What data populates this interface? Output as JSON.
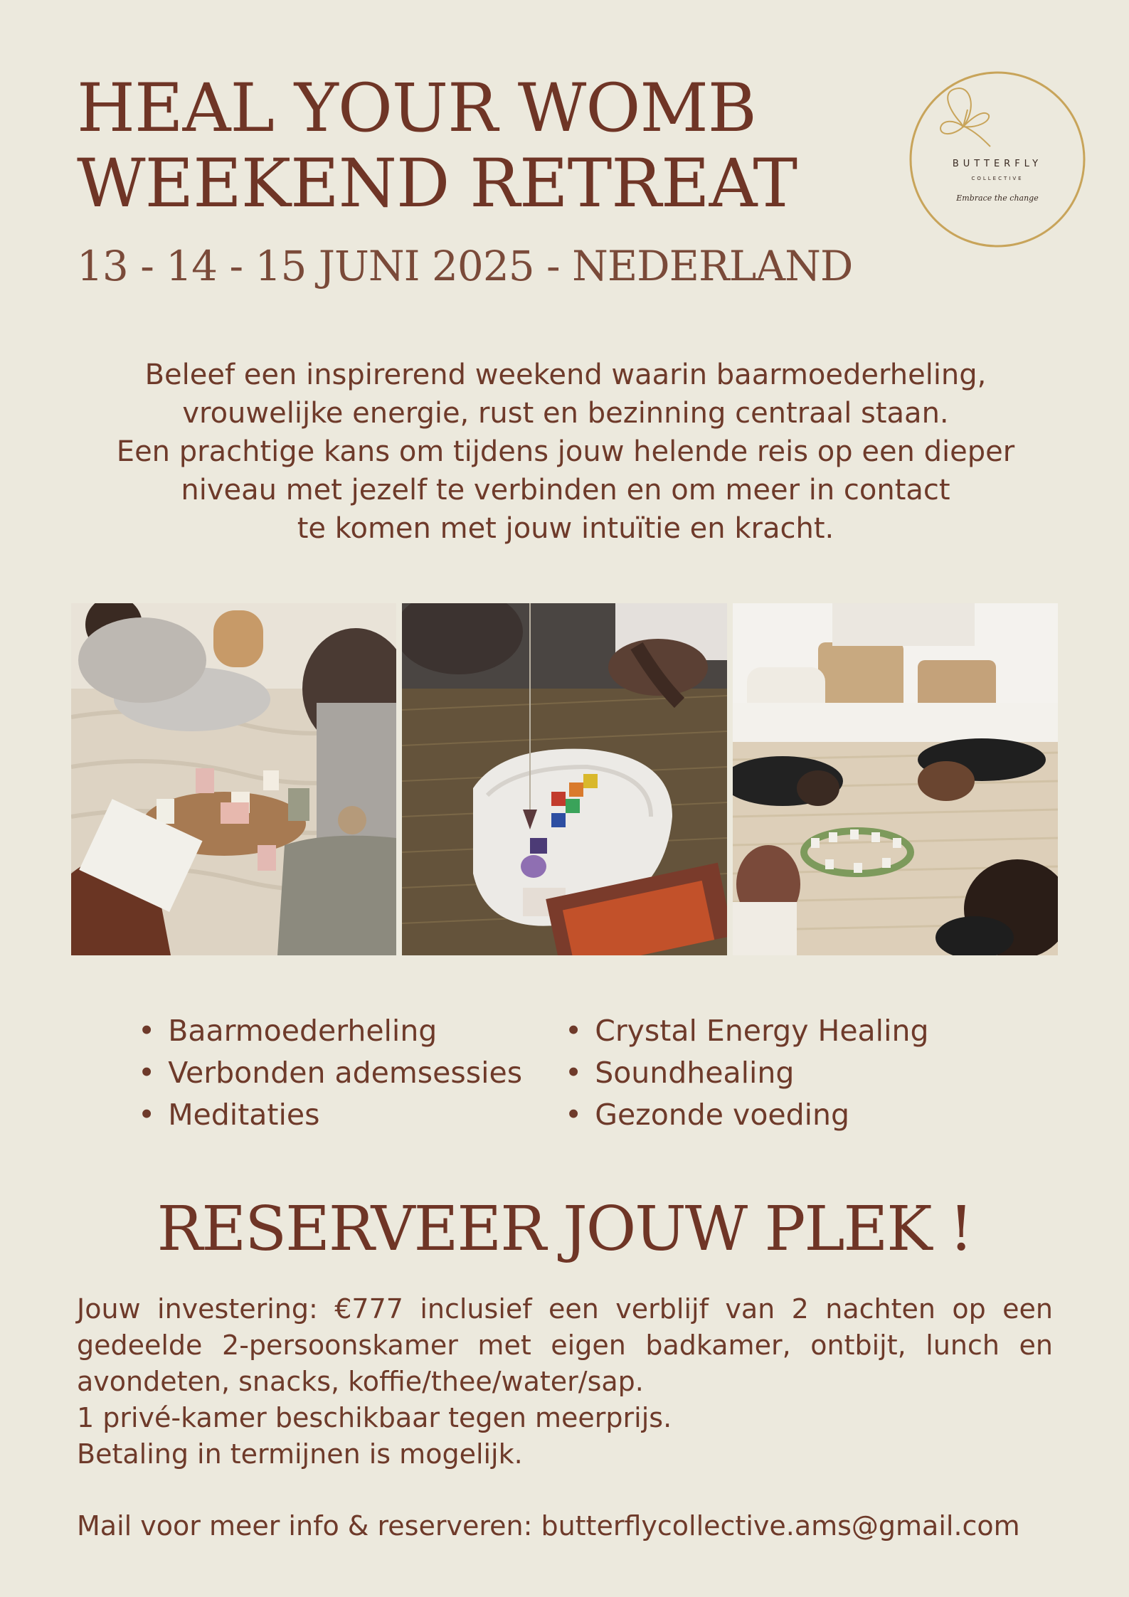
{
  "header": {
    "title_line1": "HEAL YOUR WOMB",
    "title_line2": "WEEKEND RETREAT",
    "dateline": "13 - 14 - 15 JUNI 2025 - NEDERLAND"
  },
  "logo": {
    "brand": "BUTTERFLY",
    "sub": "COLLECTIVE",
    "tagline": "Embrace the change",
    "icon": "butterfly-icon"
  },
  "intro": {
    "lines": [
      "Beleef een inspirerend weekend waarin baarmoederheling,",
      "vrouwelijke energie, rust en bezinning centraal staan.",
      "Een prachtige kans om tijdens jouw helende reis op een dieper",
      "niveau met jezelf te verbinden en om meer in contact",
      "te komen met jouw intuïtie en kracht."
    ]
  },
  "features": {
    "left": [
      "Baarmoederheling",
      "Verbonden ademsessies",
      "Meditaties"
    ],
    "right": [
      "Crystal Energy Healing",
      "Soundhealing",
      "Gezonde voeding"
    ]
  },
  "cta": "RESERVEER JOUW PLEK !",
  "details": {
    "lines": [
      "Jouw investering: €777 inclusief een verblijf van 2 nachten op een",
      "gedeelde 2-persoonskamer met eigen badkamer, ontbijt, lunch en",
      "avondeten, snacks, koffie/thee/water/sap.",
      "1 privé-kamer beschikbaar tegen meerprijs.",
      "Betaling in termijnen is mogelijk."
    ],
    "mail": "Mail voor meer info & reserveren: butterflycollective.ams@gmail.com"
  },
  "colors": {
    "background": "#ece9dd",
    "text": "#6e3a2a",
    "gold": "#c8a45a"
  }
}
